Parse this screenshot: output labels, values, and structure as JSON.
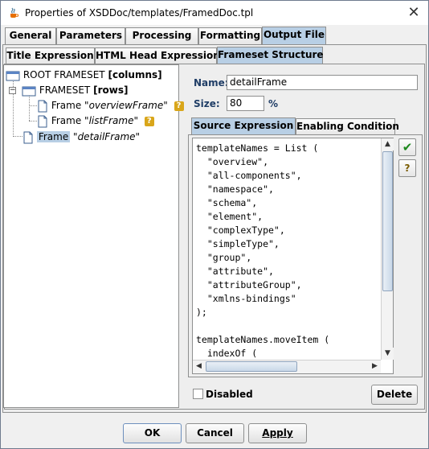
{
  "window": {
    "title": "Properties of XSDDoc/templates/FramedDoc.tpl",
    "close_glyph": "✕"
  },
  "main_tabs": [
    {
      "label": "General",
      "selected": false
    },
    {
      "label": "Parameters",
      "selected": false
    },
    {
      "label": "Processing",
      "selected": false
    },
    {
      "label": "Formatting",
      "selected": false
    },
    {
      "label": "Output File",
      "selected": true
    }
  ],
  "sub_tabs": [
    {
      "label": "Title Expression",
      "selected": false
    },
    {
      "label": "HTML Head Expression",
      "selected": false
    },
    {
      "label": "Frameset Structure",
      "selected": true
    }
  ],
  "tree": {
    "root": {
      "kind": "ROOT FRAMESET",
      "mode": "[columns]"
    },
    "frameset": {
      "kind": "FRAMESET",
      "mode": "[rows]",
      "expander": "−"
    },
    "frames": [
      {
        "kind": "Frame",
        "name": "\"overviewFrame\"",
        "badge": "?"
      },
      {
        "kind": "Frame",
        "name": "\"listFrame\"",
        "badge": "?"
      },
      {
        "kind": "Frame",
        "name": "\"detailFrame\""
      }
    ]
  },
  "props": {
    "name_label": "Name:",
    "name_value": "detailFrame",
    "size_label": "Size:",
    "size_value": "80",
    "size_unit": "%"
  },
  "expr_tabs": [
    {
      "label": "Source Expression",
      "selected": true
    },
    {
      "label": "Enabling Condition",
      "selected": false
    }
  ],
  "code": "templateNames = List (\n  \"overview\",\n  \"all-components\",\n  \"namespace\",\n  \"schema\",\n  \"element\",\n  \"complexType\",\n  \"simpleType\",\n  \"group\",\n  \"attribute\",\n  \"attributeGroup\",\n  \"xmlns-bindings\"\n);\n\ntemplateNames.moveItem (\n  indexOf (",
  "side_buttons": {
    "ok_glyph": "✔",
    "help_glyph": "?"
  },
  "disabled_checkbox": {
    "label": "Disabled",
    "checked": false
  },
  "delete_button": "Delete",
  "footer": {
    "ok": "OK",
    "cancel": "Cancel",
    "apply": "Apply"
  },
  "colors": {
    "accent_tab": "#b8cfe5",
    "label_text": "#1f3d66",
    "badge": "#d9a61a"
  }
}
